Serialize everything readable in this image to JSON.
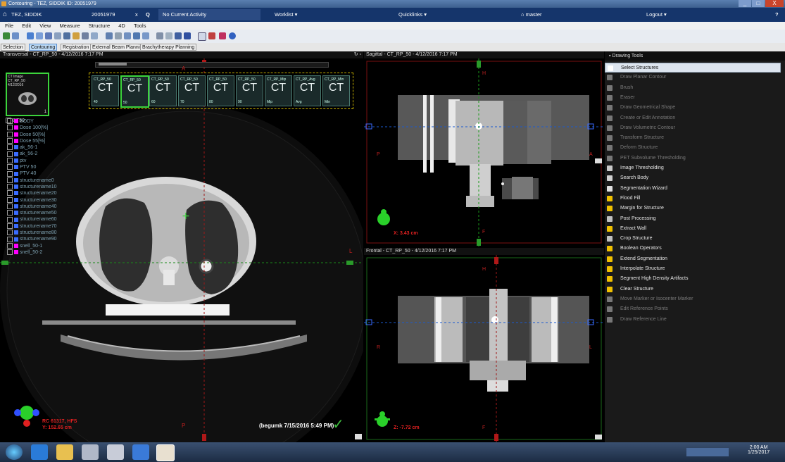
{
  "window": {
    "title": "Contouring - TEZ, SIDDIK  ID: 20051979",
    "min": "_",
    "max": "□",
    "close": "X"
  },
  "topnav": {
    "home": "⌂",
    "patient": "TEZ, SIDDIK",
    "patient_id": "20051979",
    "close_x": "x",
    "search": "Q",
    "activity": "No Current Activity",
    "worklist": "Worklist",
    "quicklinks": "Quicklinks",
    "user": "master",
    "logout": "Logout",
    "help": "?"
  },
  "menu": [
    "File",
    "Edit",
    "View",
    "Measure",
    "Structure",
    "4D",
    "Tools"
  ],
  "tabs": [
    "Selection",
    "Contouring",
    "Registration",
    "External Beam Planning",
    "Brachytherapy Planning"
  ],
  "active_tab": "Contouring",
  "transversal": {
    "title": "Transversal - CT_RP_50 - 4/12/2016 7:17 PM",
    "image_label": {
      "l1": "CT Image",
      "l2": "CT_RP_50",
      "l3": "4/12/2016"
    },
    "image_label_num": "1",
    "dataset": "CT50",
    "thumb_ct": "CT",
    "thumbs": [
      {
        "label": "CT_RP_50",
        "bottom": "40"
      },
      {
        "label": "CT_RP_50",
        "bottom": "50"
      },
      {
        "label": "CT_RP_50",
        "bottom": "60"
      },
      {
        "label": "CT_RP_50",
        "bottom": "70"
      },
      {
        "label": "CT_RP_50",
        "bottom": "80"
      },
      {
        "label": "CT_RP_50",
        "bottom": "90"
      },
      {
        "label": "CT_RP_Mip",
        "bottom": "Mip"
      },
      {
        "label": "CT_RP_Avg",
        "bottom": "Avg"
      },
      {
        "label": "CT_RP_Min",
        "bottom": "Min"
      }
    ],
    "structures": [
      {
        "name": "BODY",
        "color": "#ff00ff"
      },
      {
        "name": "Dose 100[%]",
        "color": "#ff00ff"
      },
      {
        "name": "Dose 50[%]",
        "color": "#ff00ff"
      },
      {
        "name": "Dose 55[%]",
        "color": "#ff00ff"
      },
      {
        "name": "ak_56-1",
        "color": "#3b6cff"
      },
      {
        "name": "ak_56-2",
        "color": "#3b6cff"
      },
      {
        "name": "ptv",
        "color": "#3b6cff"
      },
      {
        "name": "PTV 50",
        "color": "#3b6cff"
      },
      {
        "name": "PTV 40",
        "color": "#3b6cff"
      },
      {
        "name": "structurename0",
        "color": "#3b6cff"
      },
      {
        "name": "structurename10",
        "color": "#3b6cff"
      },
      {
        "name": "structurename20",
        "color": "#3b6cff"
      },
      {
        "name": "structurename30",
        "color": "#3b6cff"
      },
      {
        "name": "structurename40",
        "color": "#3b6cff"
      },
      {
        "name": "structurename50",
        "color": "#3b6cff"
      },
      {
        "name": "structurename60",
        "color": "#3b6cff"
      },
      {
        "name": "structurename70",
        "color": "#3b6cff"
      },
      {
        "name": "structurename80",
        "color": "#3b6cff"
      },
      {
        "name": "structurename90",
        "color": "#3b6cff"
      },
      {
        "name": "snell_50-1",
        "color": "#ff00ff"
      },
      {
        "name": "snell_50-2",
        "color": "#ff00ff"
      }
    ],
    "dir_label_top": "A",
    "dir_label_bottom": "P",
    "dir_label_right": "L",
    "coord1": "RC 61317, HFS",
    "coord2": "Y: 152.65 cm",
    "approval": "(begumk 7/15/2016 5:49 PM)"
  },
  "sagittal": {
    "title": "Sagittal - CT_RP_50 - 4/12/2016 7:17 PM",
    "dir_top": "H",
    "dir_left": "P",
    "dir_right": "A",
    "dir_bottom": "F",
    "coord": "X: 3.43 cm"
  },
  "frontal": {
    "title": "Frontal - CT_RP_50 - 4/12/2016 7:17 PM",
    "dir_top": "H",
    "dir_left": "R",
    "dir_right": "L",
    "dir_bottom": "F",
    "coord": "Z: -7.72 cm"
  },
  "drawing_tools": {
    "title": "Drawing Tools",
    "items": [
      {
        "label": "Select Structures",
        "enabled": true,
        "selected": true,
        "icon": "cursor-icon",
        "color": "#ffffff"
      },
      {
        "label": "Draw Planar Contour",
        "enabled": false,
        "icon": "pen-icon",
        "color": "#777777"
      },
      {
        "label": "Brush",
        "enabled": false,
        "icon": "brush-icon",
        "color": "#777777"
      },
      {
        "label": "Eraser",
        "enabled": false,
        "icon": "eraser-icon",
        "color": "#777777"
      },
      {
        "label": "Draw Geometrical Shape",
        "enabled": false,
        "icon": "shape-icon",
        "color": "#777777"
      },
      {
        "label": "Create or Edit Annotation",
        "enabled": false,
        "icon": "annotation-icon",
        "color": "#777777"
      },
      {
        "label": "Draw Volumetric Contour",
        "enabled": false,
        "icon": "volume-icon",
        "color": "#777777"
      },
      {
        "label": "Transform Structure",
        "enabled": false,
        "icon": "transform-icon",
        "color": "#777777"
      },
      {
        "label": "Deform Structure",
        "enabled": false,
        "icon": "deform-icon",
        "color": "#777777"
      },
      {
        "label": "PET Subvolume Thresholding",
        "enabled": false,
        "icon": "pet-icon",
        "color": "#777777"
      },
      {
        "label": "Image Thresholding",
        "enabled": true,
        "icon": "threshold-icon",
        "color": "#c9c9c9"
      },
      {
        "label": "Search Body",
        "enabled": true,
        "icon": "search-body-icon",
        "color": "#d0d0d0"
      },
      {
        "label": "Segmentation Wizard",
        "enabled": true,
        "icon": "wand-icon",
        "color": "#e0e0e0"
      },
      {
        "label": "Flood Fill",
        "enabled": true,
        "icon": "flood-icon",
        "color": "#f0c000"
      },
      {
        "label": "Margin for Structure",
        "enabled": true,
        "icon": "margin-icon",
        "color": "#f0c000"
      },
      {
        "label": "Post Processing",
        "enabled": true,
        "icon": "post-icon",
        "color": "#c0c0c0"
      },
      {
        "label": "Extract Wall",
        "enabled": true,
        "icon": "wall-icon",
        "color": "#f0c000"
      },
      {
        "label": "Crop Structure",
        "enabled": true,
        "icon": "crop-icon",
        "color": "#c0c0c0"
      },
      {
        "label": "Boolean Operators",
        "enabled": true,
        "icon": "boolean-icon",
        "color": "#f0c000"
      },
      {
        "label": "Extend Segmentation",
        "enabled": true,
        "icon": "extend-icon",
        "color": "#f0c000"
      },
      {
        "label": "Interpolate Structure",
        "enabled": true,
        "icon": "interpolate-icon",
        "color": "#f0c000"
      },
      {
        "label": "Segment High Density Artifacts",
        "enabled": true,
        "icon": "artifact-icon",
        "color": "#f0c000"
      },
      {
        "label": "Clear Structure",
        "enabled": true,
        "icon": "clear-icon",
        "color": "#f0c000"
      },
      {
        "label": "Move Marker or Isocenter Marker",
        "enabled": false,
        "icon": "marker-icon",
        "color": "#777777"
      },
      {
        "label": "Edit Reference Points",
        "enabled": false,
        "icon": "refpoint-icon",
        "color": "#777777"
      },
      {
        "label": "Draw Reference Line",
        "enabled": false,
        "icon": "refline-icon",
        "color": "#777777"
      }
    ]
  },
  "taskbar": {
    "time": "2:00 AM",
    "date": "1/25/2017"
  }
}
